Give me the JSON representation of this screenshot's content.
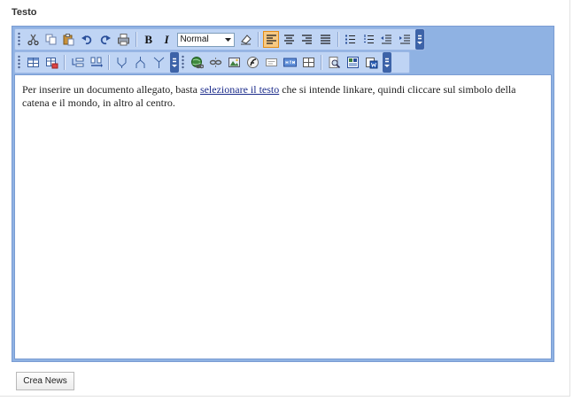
{
  "field": {
    "label": "Testo"
  },
  "toolbar": {
    "format_value": "Normal",
    "bold_label": "B",
    "italic_label": "I"
  },
  "content": {
    "text_before": "Per inserire un documento allegato, basta ",
    "link_text": "selezionare il testo",
    "text_after": " che si intende linkare, quindi cliccare sul simbolo della catena e il mondo, in altro al centro."
  },
  "actions": {
    "submit_label": "Crea News"
  },
  "colors": {
    "toolbar_bg": "#bfd4f4",
    "editor_border": "#8fb2e3",
    "active_button": "#f7c982",
    "link": "#1a2a8a"
  },
  "icons": [
    "cut-icon",
    "copy-icon",
    "paste-icon",
    "undo-icon",
    "redo-icon",
    "print-icon",
    "bold-icon",
    "italic-icon",
    "eraser-icon",
    "align-left-icon",
    "align-center-icon",
    "align-right-icon",
    "justify-icon",
    "bulleted-list-icon",
    "numbered-list-icon",
    "outdent-icon",
    "indent-icon",
    "table-icon",
    "table-properties-icon",
    "insert-row-icon",
    "insert-column-icon",
    "merge-cells-icon",
    "split-cells-icon",
    "delete-cells-icon",
    "link-icon",
    "unlink-icon",
    "image-icon",
    "flash-icon",
    "form-icon",
    "html-icon",
    "special-char-icon",
    "preview-icon",
    "template-icon",
    "paste-word-icon"
  ]
}
